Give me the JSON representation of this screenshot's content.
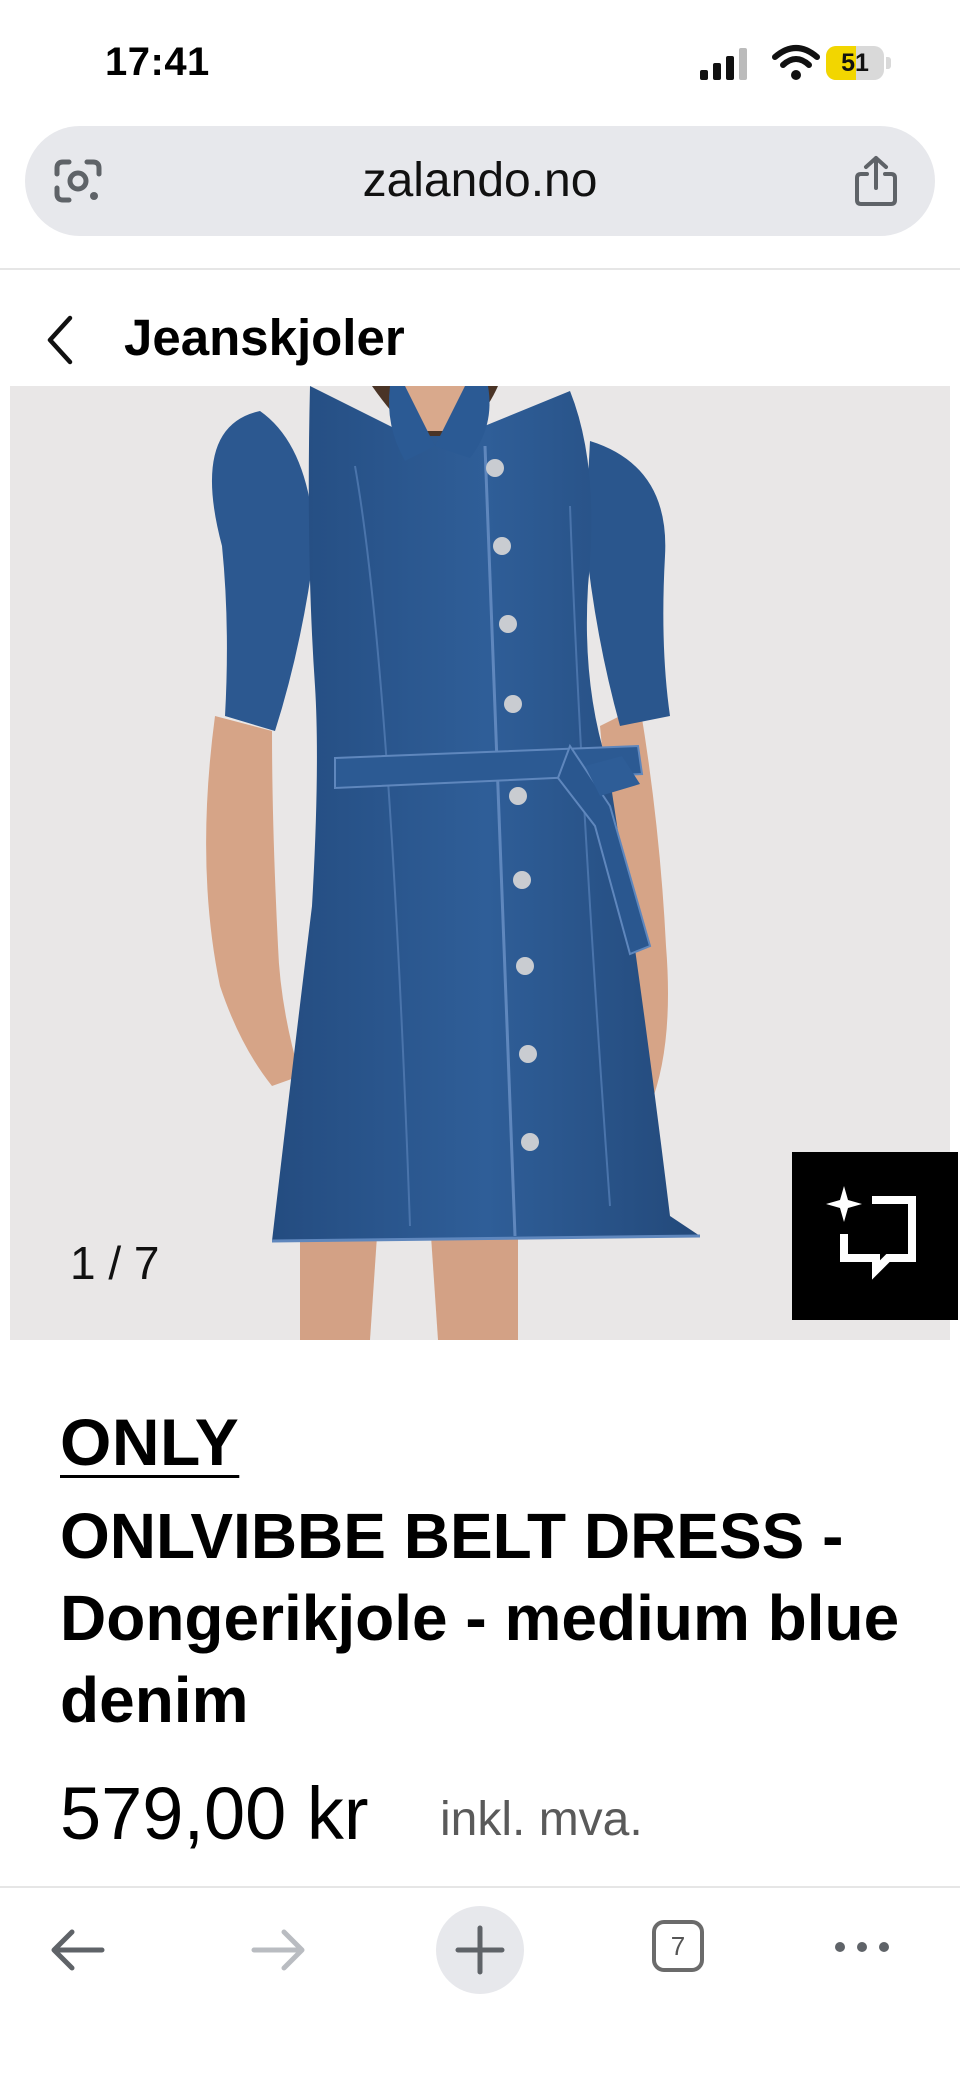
{
  "status_bar": {
    "time": "17:41",
    "battery_level": "51",
    "battery_fraction": 0.51
  },
  "browser": {
    "url": "zalando.no",
    "open_tabs": "7"
  },
  "page": {
    "category": "Jeanskjoler"
  },
  "gallery": {
    "counter": "1 / 7"
  },
  "product": {
    "brand": "ONLY",
    "name": "ONLVIBBE BELT DRESS - Dongerikjole - medium blue denim",
    "price": "579,00 kr",
    "vat_note": "inkl. mva."
  },
  "colors": {
    "denim": "#2d5a93",
    "url_bar": "#e7e8ec",
    "photo_bg": "#e9e7e7",
    "battery": "#f2d600"
  },
  "icons": [
    "signal-icon",
    "wifi-icon",
    "battery-icon",
    "google-lens-icon",
    "share-icon",
    "chevron-left-icon",
    "ai-try-on-icon",
    "arrow-left-icon",
    "arrow-right-icon",
    "plus-icon",
    "tabs-icon",
    "more-icon"
  ]
}
